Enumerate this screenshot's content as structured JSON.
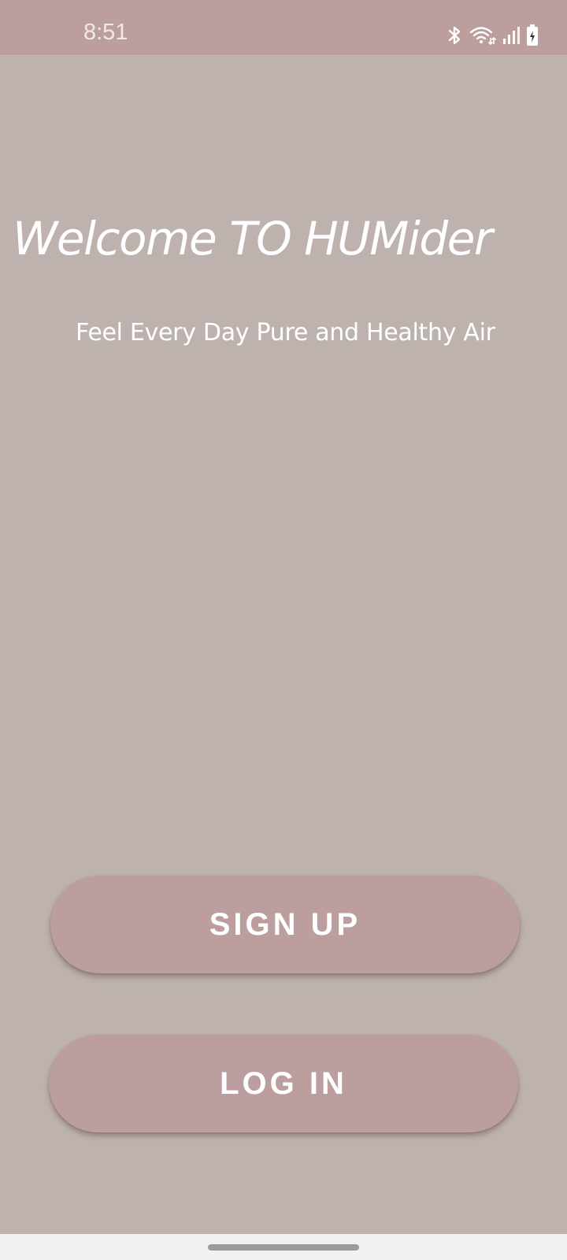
{
  "status_bar": {
    "time": "8:51",
    "icons": [
      "bluetooth-icon",
      "wifi-icon",
      "signal-icon",
      "battery-charging-icon"
    ]
  },
  "main": {
    "title": "Welcome TO HUMider",
    "tagline": "Feel Every Day Pure and Healthy Air"
  },
  "actions": {
    "signup_label": "SIGN UP",
    "login_label": "LOG IN"
  },
  "colors": {
    "background": "#bdb2ae",
    "accent": "#bc9e9f",
    "text": "#ffffff"
  }
}
